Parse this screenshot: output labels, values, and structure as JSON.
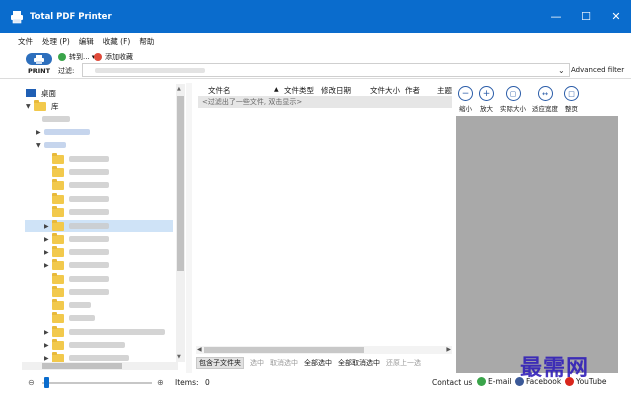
{
  "window": {
    "title": "Total PDF Printer"
  },
  "menu": [
    "文件",
    "处理 (P)",
    "编辑",
    "收藏 (F)",
    "帮助"
  ],
  "toolbar": {
    "print_label": "PRINT",
    "goto_label": "转到...",
    "add_fav_label": "添加收藏",
    "filter_label": "过滤:",
    "advanced_filter_label": "Advanced filter"
  },
  "tree": {
    "desktop_label": "桌面",
    "root_label": "库"
  },
  "file_list": {
    "columns": [
      "文件名",
      "文件类型",
      "修改日期",
      "文件大小",
      "作者",
      "主题"
    ],
    "filter_hint": "<过滤出了一些文件, 双击显示>"
  },
  "actions": [
    "包含子文件夹",
    "选中",
    "取消选中",
    "全部选中",
    "全部取消选中",
    "还原上一选"
  ],
  "zoom": [
    "缩小",
    "放大",
    "实际大小",
    "适应宽度",
    "整页"
  ],
  "status": {
    "items_label": "Items:",
    "items_count": "0",
    "contact_label": "Contact us",
    "email_label": "E-mail",
    "facebook_label": "Facebook",
    "youtube_label": "YouTube"
  },
  "watermark": "最需网",
  "colors": {
    "titlebar": "#0a6ccd",
    "preview": "#a9a9a9",
    "selection": "#cfe3f7",
    "watermark": "#2d1bb8"
  }
}
